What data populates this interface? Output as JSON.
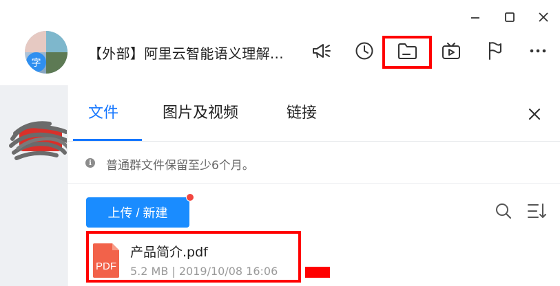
{
  "window": {
    "controls": [
      "minimize-icon",
      "maximize-icon",
      "close-icon"
    ]
  },
  "header": {
    "avatar_badge": "字",
    "title": "【外部】阿里云智能语义理解...",
    "icons": [
      "megaphone-icon",
      "clock-icon",
      "folder-icon",
      "tv-icon",
      "flag-icon",
      "more-icon"
    ]
  },
  "panel": {
    "tabs": [
      {
        "label": "文件",
        "active": true
      },
      {
        "label": "图片及视频",
        "active": false
      },
      {
        "label": "链接",
        "active": false
      }
    ],
    "notice": "普通群文件保留至少6个月。",
    "upload_button": "上传 / 新建",
    "files": [
      {
        "icon_text": "PDF",
        "name": "产品简介.pdf",
        "meta": "5.2 MB  |  2019/10/08 16:06"
      }
    ]
  },
  "colors": {
    "accent": "#1677ff",
    "button": "#1a8cff",
    "highlight": "#ff0000",
    "pdf": "#f2624a"
  }
}
